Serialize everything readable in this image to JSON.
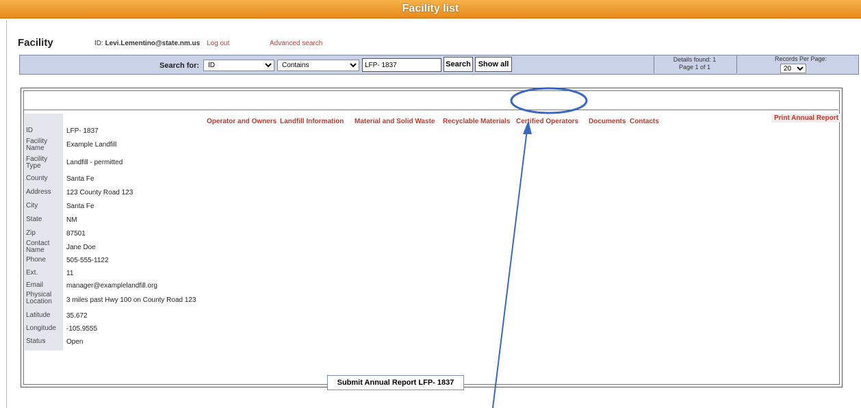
{
  "window": {
    "title": "Facility list"
  },
  "header": {
    "page_title": "Facility",
    "user_id_prefix": "ID: ",
    "user_email": "Levi.Lementino@state.nm.us",
    "logout_label": "Log out",
    "advanced_search_label": "Advanced search"
  },
  "search": {
    "label": "Search for:",
    "field_value": "ID",
    "operator_value": "Contains",
    "query_value": "LFP- 1837",
    "search_button": "Search",
    "show_all_button": "Show all",
    "details_found": "Details found: 1",
    "page_info": "Page 1 of 1",
    "records_per_page_label": "Records Per Page:",
    "records_per_page_value": "20"
  },
  "tabs": [
    {
      "label": "Operator and Owners"
    },
    {
      "label": "Landfill Information"
    },
    {
      "label": "Material and Solid Waste"
    },
    {
      "label": "Recyclable Materials"
    },
    {
      "label": "Certified Operators"
    },
    {
      "label": "Documents"
    },
    {
      "label": "Contacts"
    }
  ],
  "print_report_label": "Print Annual Report",
  "details": [
    {
      "label": "ID",
      "value": "LFP- 1837"
    },
    {
      "label": "Facility Name",
      "value": "Example Landfill"
    },
    {
      "label": "Facility Type",
      "value": "Landfill - permitted"
    },
    {
      "label": "County",
      "value": "Santa Fe"
    },
    {
      "label": "Address",
      "value": "123 County Road 123"
    },
    {
      "label": "City",
      "value": "Santa Fe"
    },
    {
      "label": "State",
      "value": "NM"
    },
    {
      "label": "Zip",
      "value": "87501"
    },
    {
      "label": "Contact Name",
      "value": "Jane Doe"
    },
    {
      "label": "Phone",
      "value": "505-555-1122"
    },
    {
      "label": "Ext.",
      "value": "11"
    },
    {
      "label": "Email",
      "value": "manager@examplelandfill.org"
    },
    {
      "label": "Physical Location",
      "value": "3 miles past Hwy 100 on County Road 123"
    },
    {
      "label": "Latitude",
      "value": "35.672"
    },
    {
      "label": "Longitude",
      "value": "-105.9555"
    },
    {
      "label": "Status",
      "value": "Open"
    }
  ],
  "submit_button": "Submit Annual Report LFP- 1837",
  "colors": {
    "title_bar": "#e88a1a",
    "link_red": "#c0392b",
    "search_bar": "#c9d2e6",
    "annotation_blue": "#3a66c4"
  }
}
